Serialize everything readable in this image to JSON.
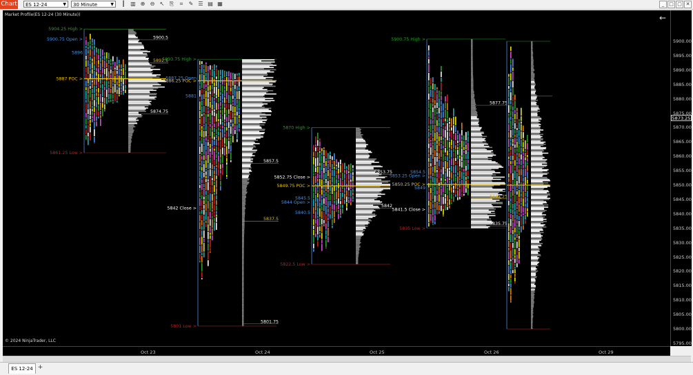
{
  "toolbar": {
    "chart_tab": "Chart",
    "instrument": "ES 12-24",
    "interval": "30 Minute",
    "icons": [
      "bar-type-icon",
      "bar-chart-icon",
      "zoom-icon",
      "zoom-out-icon",
      "pointer-icon",
      "strategy-icon",
      "indicator-icon",
      "drawing-icon",
      "properties-icon",
      "data-box-icon",
      "grid-icon"
    ]
  },
  "window_controls": [
    "_",
    "□",
    "▢",
    "✕"
  ],
  "chart": {
    "title": "Market Profile(ES 12-24 (30 Minute))",
    "copyright": "© 2024 NinjaTrader, LLC",
    "current_price": "5873.25",
    "price_ticks": [
      "5900.00",
      "5895.00",
      "5890.00",
      "5885.00",
      "5880.00",
      "5875.00",
      "5870.00",
      "5865.00",
      "5860.00",
      "5855.00",
      "5850.00",
      "5845.00",
      "5840.00",
      "5835.00",
      "5830.00",
      "5825.00",
      "5820.00",
      "5815.00",
      "5810.00",
      "5805.00",
      "5800.00",
      "5795.00"
    ],
    "time_ticks": [
      "Oct 23",
      "Oct 24",
      "Oct 25",
      "Oct 26",
      "Oct 29"
    ]
  },
  "chart_data": {
    "type": "market-profile",
    "y_axis_range": [
      5795,
      5905
    ],
    "sessions": [
      {
        "name": "session-1",
        "labels": [
          {
            "text": "5904.25 High >",
            "price": 5904.25,
            "color": "#2e9e2e",
            "side": "left"
          },
          {
            "text": "5900.75 Open >",
            "price": 5900.75,
            "color": "#4a90e2",
            "side": "left"
          },
          {
            "text": "5896",
            "price": 5896,
            "color": "#4a90e2",
            "side": "left"
          },
          {
            "text": "5887 POC >",
            "price": 5887,
            "color": "#e8c000",
            "side": "left"
          },
          {
            "text": "5861.25 Low >",
            "price": 5861.25,
            "color": "#c02020",
            "side": "left"
          },
          {
            "text": "5900.5",
            "price": 5900.5,
            "color": "#ffffff",
            "side": "right"
          },
          {
            "text": "5892.5",
            "price": 5892.5,
            "color": "#e8c000",
            "side": "right"
          },
          {
            "text": "5874.75",
            "price": 5874.75,
            "color": "#ffffff",
            "side": "right"
          }
        ]
      },
      {
        "name": "session-2",
        "labels": [
          {
            "text": "5893.75 High >",
            "price": 5893.75,
            "color": "#2e9e2e",
            "side": "left"
          },
          {
            "text": "5887.25 Open",
            "price": 5887.25,
            "color": "#4a90e2",
            "side": "left"
          },
          {
            "text": "5886.25 POC >",
            "price": 5886.25,
            "color": "#e8c000",
            "side": "left"
          },
          {
            "text": "5881",
            "price": 5881,
            "color": "#4a90e2",
            "side": "left"
          },
          {
            "text": "5842 Close >",
            "price": 5842,
            "color": "#ffffff",
            "side": "left"
          },
          {
            "text": "5801 Low >",
            "price": 5801,
            "color": "#c02020",
            "side": "left"
          },
          {
            "text": "5857.5",
            "price": 5857.5,
            "color": "#ffffff",
            "side": "right"
          },
          {
            "text": "5837.5",
            "price": 5837.5,
            "color": "#e8c000",
            "side": "right"
          },
          {
            "text": "5801.75",
            "price": 5801.75,
            "color": "#ffffff",
            "side": "right"
          }
        ]
      },
      {
        "name": "session-3",
        "labels": [
          {
            "text": "5870 High >",
            "price": 5870,
            "color": "#2e9e2e",
            "side": "left"
          },
          {
            "text": "5852.75 Close >",
            "price": 5852.75,
            "color": "#ffffff",
            "side": "left"
          },
          {
            "text": "5849.75 POC >",
            "price": 5849.75,
            "color": "#e8c000",
            "side": "left"
          },
          {
            "text": "5845.5",
            "price": 5845.5,
            "color": "#4a90e2",
            "side": "left"
          },
          {
            "text": "5844 Open >",
            "price": 5844,
            "color": "#4a90e2",
            "side": "left"
          },
          {
            "text": "5840.5",
            "price": 5840.5,
            "color": "#4a90e2",
            "side": "left"
          },
          {
            "text": "5822.5 Low >",
            "price": 5822.5,
            "color": "#c02020",
            "side": "left"
          },
          {
            "text": "5853.75",
            "price": 5853.75,
            "color": "#ffffff",
            "side": "right"
          },
          {
            "text": "5842",
            "price": 5842,
            "color": "#ffffff",
            "side": "right"
          }
        ]
      },
      {
        "name": "session-4",
        "labels": [
          {
            "text": "5900.75 High >",
            "price": 5900.75,
            "color": "#2e9e2e",
            "side": "left"
          },
          {
            "text": "5854.5",
            "price": 5854.5,
            "color": "#4a90e2",
            "side": "left"
          },
          {
            "text": "5853.25 Open >",
            "price": 5853.25,
            "color": "#4a90e2",
            "side": "left"
          },
          {
            "text": "5850.25 POC >",
            "price": 5850.25,
            "color": "#e8c000",
            "side": "left"
          },
          {
            "text": "5849",
            "price": 5849,
            "color": "#4a90e2",
            "side": "left"
          },
          {
            "text": "5841.5 Close >",
            "price": 5841.5,
            "color": "#ffffff",
            "side": "left"
          },
          {
            "text": "5835 Low >",
            "price": 5835,
            "color": "#c02020",
            "side": "left"
          },
          {
            "text": "5877.75",
            "price": 5877.75,
            "color": "#ffffff",
            "side": "right"
          },
          {
            "text": "5845.25",
            "price": 5845.25,
            "color": "#e8c000",
            "side": "right"
          },
          {
            "text": "5835.75",
            "price": 5835.75,
            "color": "#ffffff",
            "side": "right"
          }
        ]
      }
    ]
  },
  "tabs": {
    "active": "ES 12-24",
    "add": "+"
  }
}
